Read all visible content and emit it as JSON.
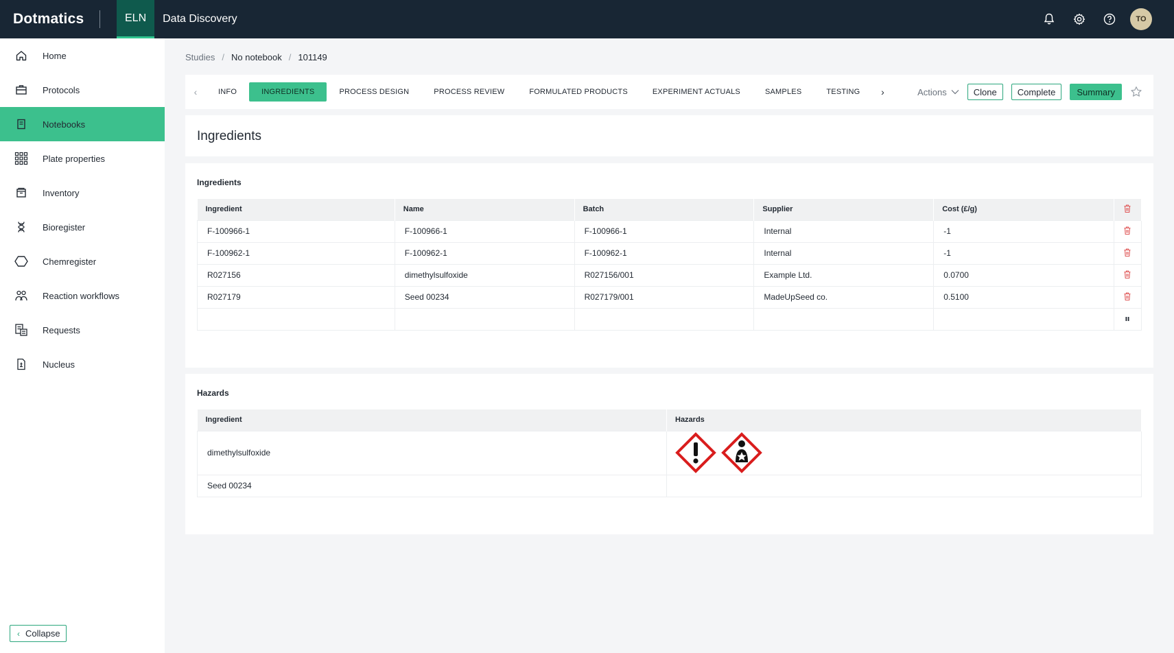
{
  "topbar": {
    "logo": "Dotmatics",
    "apps": [
      "ELN",
      "Data Discovery"
    ],
    "icons": [
      "bell-icon",
      "gear-icon",
      "help-icon"
    ],
    "avatar": "TO"
  },
  "sidebar": {
    "items": [
      {
        "label": "Home",
        "icon": "home-icon"
      },
      {
        "label": "Protocols",
        "icon": "briefcase-icon"
      },
      {
        "label": "Notebooks",
        "icon": "notebook-icon"
      },
      {
        "label": "Plate properties",
        "icon": "grid-icon"
      },
      {
        "label": "Inventory",
        "icon": "box-icon"
      },
      {
        "label": "Bioregister",
        "icon": "dna-icon"
      },
      {
        "label": "Chemregister",
        "icon": "hexagon-icon"
      },
      {
        "label": "Reaction workflows",
        "icon": "workflow-icon"
      },
      {
        "label": "Requests",
        "icon": "requests-icon"
      },
      {
        "label": "Nucleus",
        "icon": "document-icon"
      }
    ],
    "active_index": 2,
    "collapse_label": "Collapse"
  },
  "breadcrumb": [
    "Studies",
    "No notebook",
    "101149"
  ],
  "tabs": [
    "INFO",
    "INGREDIENTS",
    "PROCESS DESIGN",
    "PROCESS REVIEW",
    "FORMULATED PRODUCTS",
    "EXPERIMENT ACTUALS",
    "SAMPLES",
    "TESTING"
  ],
  "active_tab": "INGREDIENTS",
  "actions": {
    "dropdown": "Actions",
    "clone": "Clone",
    "complete": "Complete",
    "summary": "Summary"
  },
  "page_title": "Ingredients",
  "ingredients": {
    "title": "Ingredients",
    "columns": [
      "Ingredient",
      "Name",
      "Batch",
      "Supplier",
      "Cost (£/g)"
    ],
    "rows": [
      [
        "F-100966-1",
        "F-100966-1",
        "F-100966-1",
        "Internal",
        "-1"
      ],
      [
        "F-100962-1",
        "F-100962-1",
        "F-100962-1",
        "Internal",
        "-1"
      ],
      [
        "R027156",
        "dimethylsulfoxide",
        "R027156/001",
        "Example Ltd.",
        "0.0700"
      ],
      [
        "R027179",
        "Seed 00234",
        "R027179/001",
        "MadeUpSeed co.",
        "0.5100"
      ]
    ]
  },
  "hazards": {
    "title": "Hazards",
    "columns": [
      "Ingredient",
      "Hazards"
    ],
    "rows": [
      {
        "ingredient": "dimethylsulfoxide",
        "pictograms": [
          "exclamation-hazard-icon",
          "health-hazard-icon"
        ]
      },
      {
        "ingredient": "Seed 00234",
        "pictograms": []
      }
    ]
  },
  "colors": {
    "topbar": "#182634",
    "accent": "#3cc08d",
    "delete": "#e05a5a",
    "hazard_red": "#d91d1d"
  }
}
